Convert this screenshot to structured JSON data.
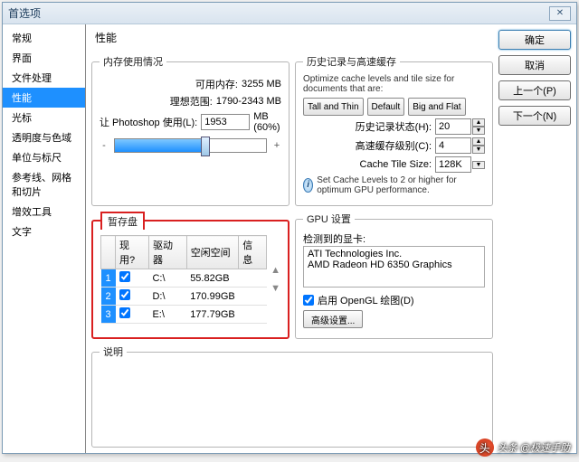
{
  "window": {
    "title": "首选项",
    "close": "✕",
    "min": "—"
  },
  "sidebar": {
    "items": [
      {
        "label": "常规"
      },
      {
        "label": "界面"
      },
      {
        "label": "文件处理"
      },
      {
        "label": "性能"
      },
      {
        "label": "光标"
      },
      {
        "label": "透明度与色域"
      },
      {
        "label": "单位与标尺"
      },
      {
        "label": "参考线、网格和切片"
      },
      {
        "label": "增效工具"
      },
      {
        "label": "文字"
      }
    ],
    "selected_index": 3
  },
  "heading": "性能",
  "memory": {
    "legend": "内存使用情况",
    "avail_label": "可用内存:",
    "avail_value": "3255 MB",
    "ideal_label": "理想范围:",
    "ideal_value": "1790-2343 MB",
    "ps_label": "让 Photoshop 使用(L):",
    "ps_value": "1953",
    "ps_unit": "MB (60%)",
    "minus": "-",
    "plus": "+"
  },
  "history": {
    "legend": "历史记录与高速缓存",
    "desc": "Optimize cache levels and tile size for documents that are:",
    "btn_tall": "Tall and Thin",
    "btn_default": "Default",
    "btn_big": "Big and Flat",
    "states_label": "历史记录状态(H):",
    "states_value": "20",
    "levels_label": "高速缓存级别(C):",
    "levels_value": "4",
    "tile_label": "Cache Tile Size:",
    "tile_value": "128K",
    "hint": "Set Cache Levels to 2 or higher for optimum GPU performance."
  },
  "scratch": {
    "legend": "暂存盘",
    "col_active": "现用?",
    "col_drive": "驱动器",
    "col_free": "空闲空间",
    "col_info": "信息",
    "rows": [
      {
        "n": "1",
        "active": true,
        "drive": "C:\\",
        "free": "55.82GB",
        "info": ""
      },
      {
        "n": "2",
        "active": true,
        "drive": "D:\\",
        "free": "170.99GB",
        "info": ""
      },
      {
        "n": "3",
        "active": true,
        "drive": "E:\\",
        "free": "177.79GB",
        "info": ""
      }
    ]
  },
  "gpu": {
    "legend": "GPU 设置",
    "detected_label": "检测到的显卡:",
    "line1": "ATI Technologies Inc.",
    "line2": "AMD Radeon HD 6350 Graphics",
    "enable_label": "启用 OpenGL 绘图(D)",
    "enable_checked": true,
    "adv_btn": "高级设置..."
  },
  "desc_panel": {
    "legend": "说明"
  },
  "buttons": {
    "ok": "确定",
    "cancel": "取消",
    "prev": "上一个(P)",
    "next": "下一个(N)"
  },
  "watermark": {
    "text": "头条 @极速手助"
  }
}
